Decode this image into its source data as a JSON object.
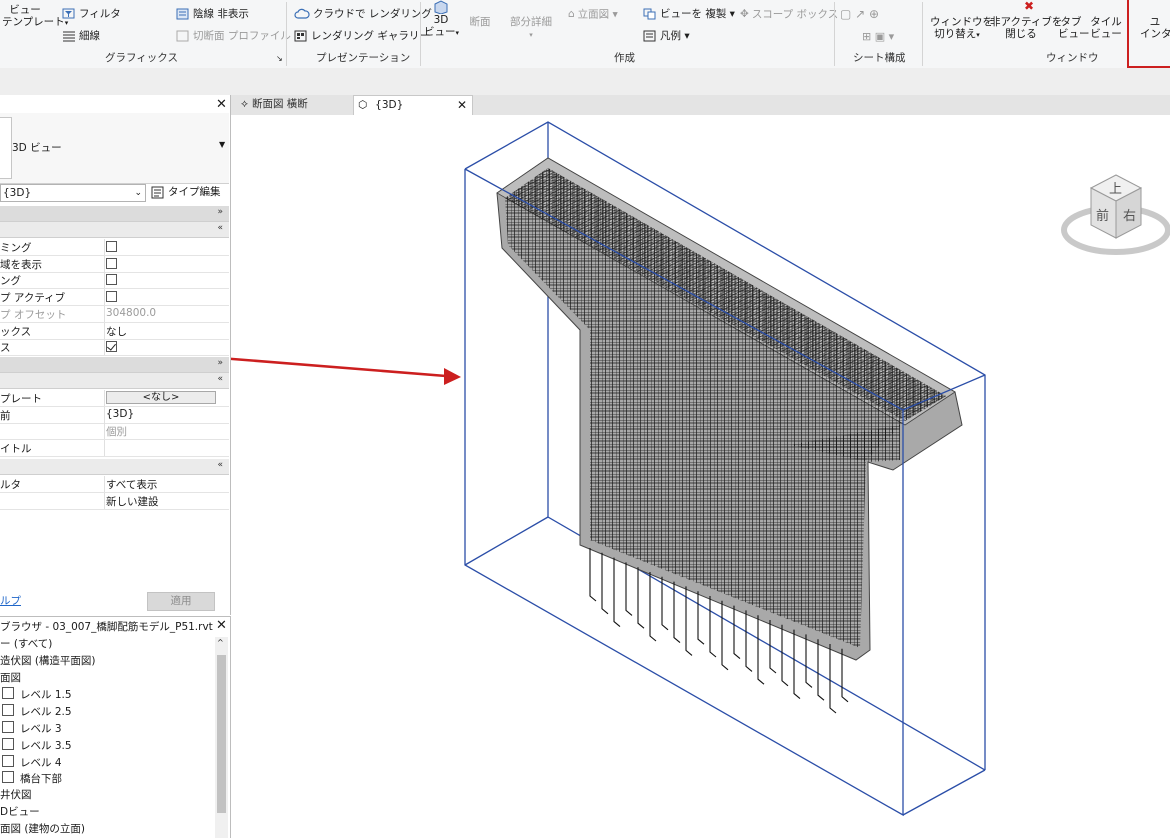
{
  "ribbon": {
    "view_templates": {
      "line1": "ビュー",
      "line2": "テンプレート"
    },
    "filter": "フィルタ",
    "thin_lines": "細線",
    "hide_lines": "陰線 非表示",
    "section_profile": "切断面 プロファイル",
    "graphics_group": "グラフィックス",
    "render_cloud": "クラウドで レンダリング",
    "render_gallery": "レンダリング ギャラリー",
    "presentation_group": "プレゼンテーション",
    "view_3d": {
      "line1": "3D",
      "line2": "ビュー"
    },
    "section": "断面",
    "callout": "部分詳細",
    "elevation": "立面図",
    "duplicate_view": "ビューを 複製",
    "scope_box": "スコープ ボックス",
    "legend": "凡例",
    "create_group": "作成",
    "sheet_group": "シート構成",
    "switch_windows": {
      "line1": "ウィンドウを",
      "line2": "切り替え"
    },
    "close_inactive": {
      "line1": "非アクティブを",
      "line2": "閉じる"
    },
    "tab_views": {
      "line1": "タブ",
      "line2": "ビュー"
    },
    "tile_views": {
      "line1": "タイル",
      "line2": "ビュー"
    },
    "window_group": "ウィンドウ",
    "user_interface": {
      "line1": "ユ",
      "line2": "インタ"
    }
  },
  "properties": {
    "type_name": "3D ビュー",
    "instance_selector": "{3D}",
    "edit_type": "タイプ編集",
    "groups": [
      {
        "rows": [
          {
            "key": "ミング",
            "type": "checkbox",
            "checked": false
          },
          {
            "key": "域を表示",
            "type": "checkbox",
            "checked": false
          },
          {
            "key": "ング",
            "type": "checkbox",
            "checked": false
          },
          {
            "key": "プ アクティブ",
            "type": "checkbox",
            "checked": false
          },
          {
            "key": "プ オフセット",
            "value": "304800.0",
            "disabled": true
          },
          {
            "key": "ックス",
            "value": "なし"
          },
          {
            "key": "ス",
            "type": "checkbox",
            "checked": true
          }
        ]
      },
      {
        "rows": [
          {
            "key": "プレート",
            "value": "<なし>",
            "type": "button"
          },
          {
            "key": "前",
            "value": "{3D}"
          },
          {
            "key": "",
            "value": "個別",
            "disabled": true
          },
          {
            "key": "イトル",
            "value": ""
          }
        ]
      },
      {
        "rows": [
          {
            "key": "ルタ",
            "value": "すべて表示"
          },
          {
            "key": "",
            "value": "新しい建設"
          }
        ]
      }
    ],
    "help_link": "ルプ",
    "apply_button": "適用"
  },
  "browser": {
    "title": "ブラウザ - 03_007_橋脚配筋モデル_P51.rvt",
    "items": [
      {
        "label": "ー (すべて)",
        "indent": 0
      },
      {
        "label": "造伏図 (構造平面図)",
        "indent": 0
      },
      {
        "label": "面図",
        "indent": 0
      },
      {
        "label": "レベル 1.5",
        "indent": 1
      },
      {
        "label": "レベル 2.5",
        "indent": 1
      },
      {
        "label": "レベル 3",
        "indent": 1
      },
      {
        "label": "レベル 3.5",
        "indent": 1
      },
      {
        "label": "レベル 4",
        "indent": 1
      },
      {
        "label": "橋台下部",
        "indent": 1
      },
      {
        "label": "井伏図",
        "indent": 0
      },
      {
        "label": "Dビュー",
        "indent": 0
      },
      {
        "label": "面図 (建物の立面)",
        "indent": 0
      }
    ]
  },
  "tabs": [
    {
      "label": "断面図 橫断",
      "active": false
    },
    {
      "label": "{3D}",
      "active": true
    }
  ],
  "viewcube": {
    "top": "上",
    "front": "前",
    "right": "右"
  },
  "colors": {
    "accent_red": "#cc1f1f",
    "section_box_blue": "#2b4ea8",
    "concrete_gray": "#a9a9a9"
  }
}
